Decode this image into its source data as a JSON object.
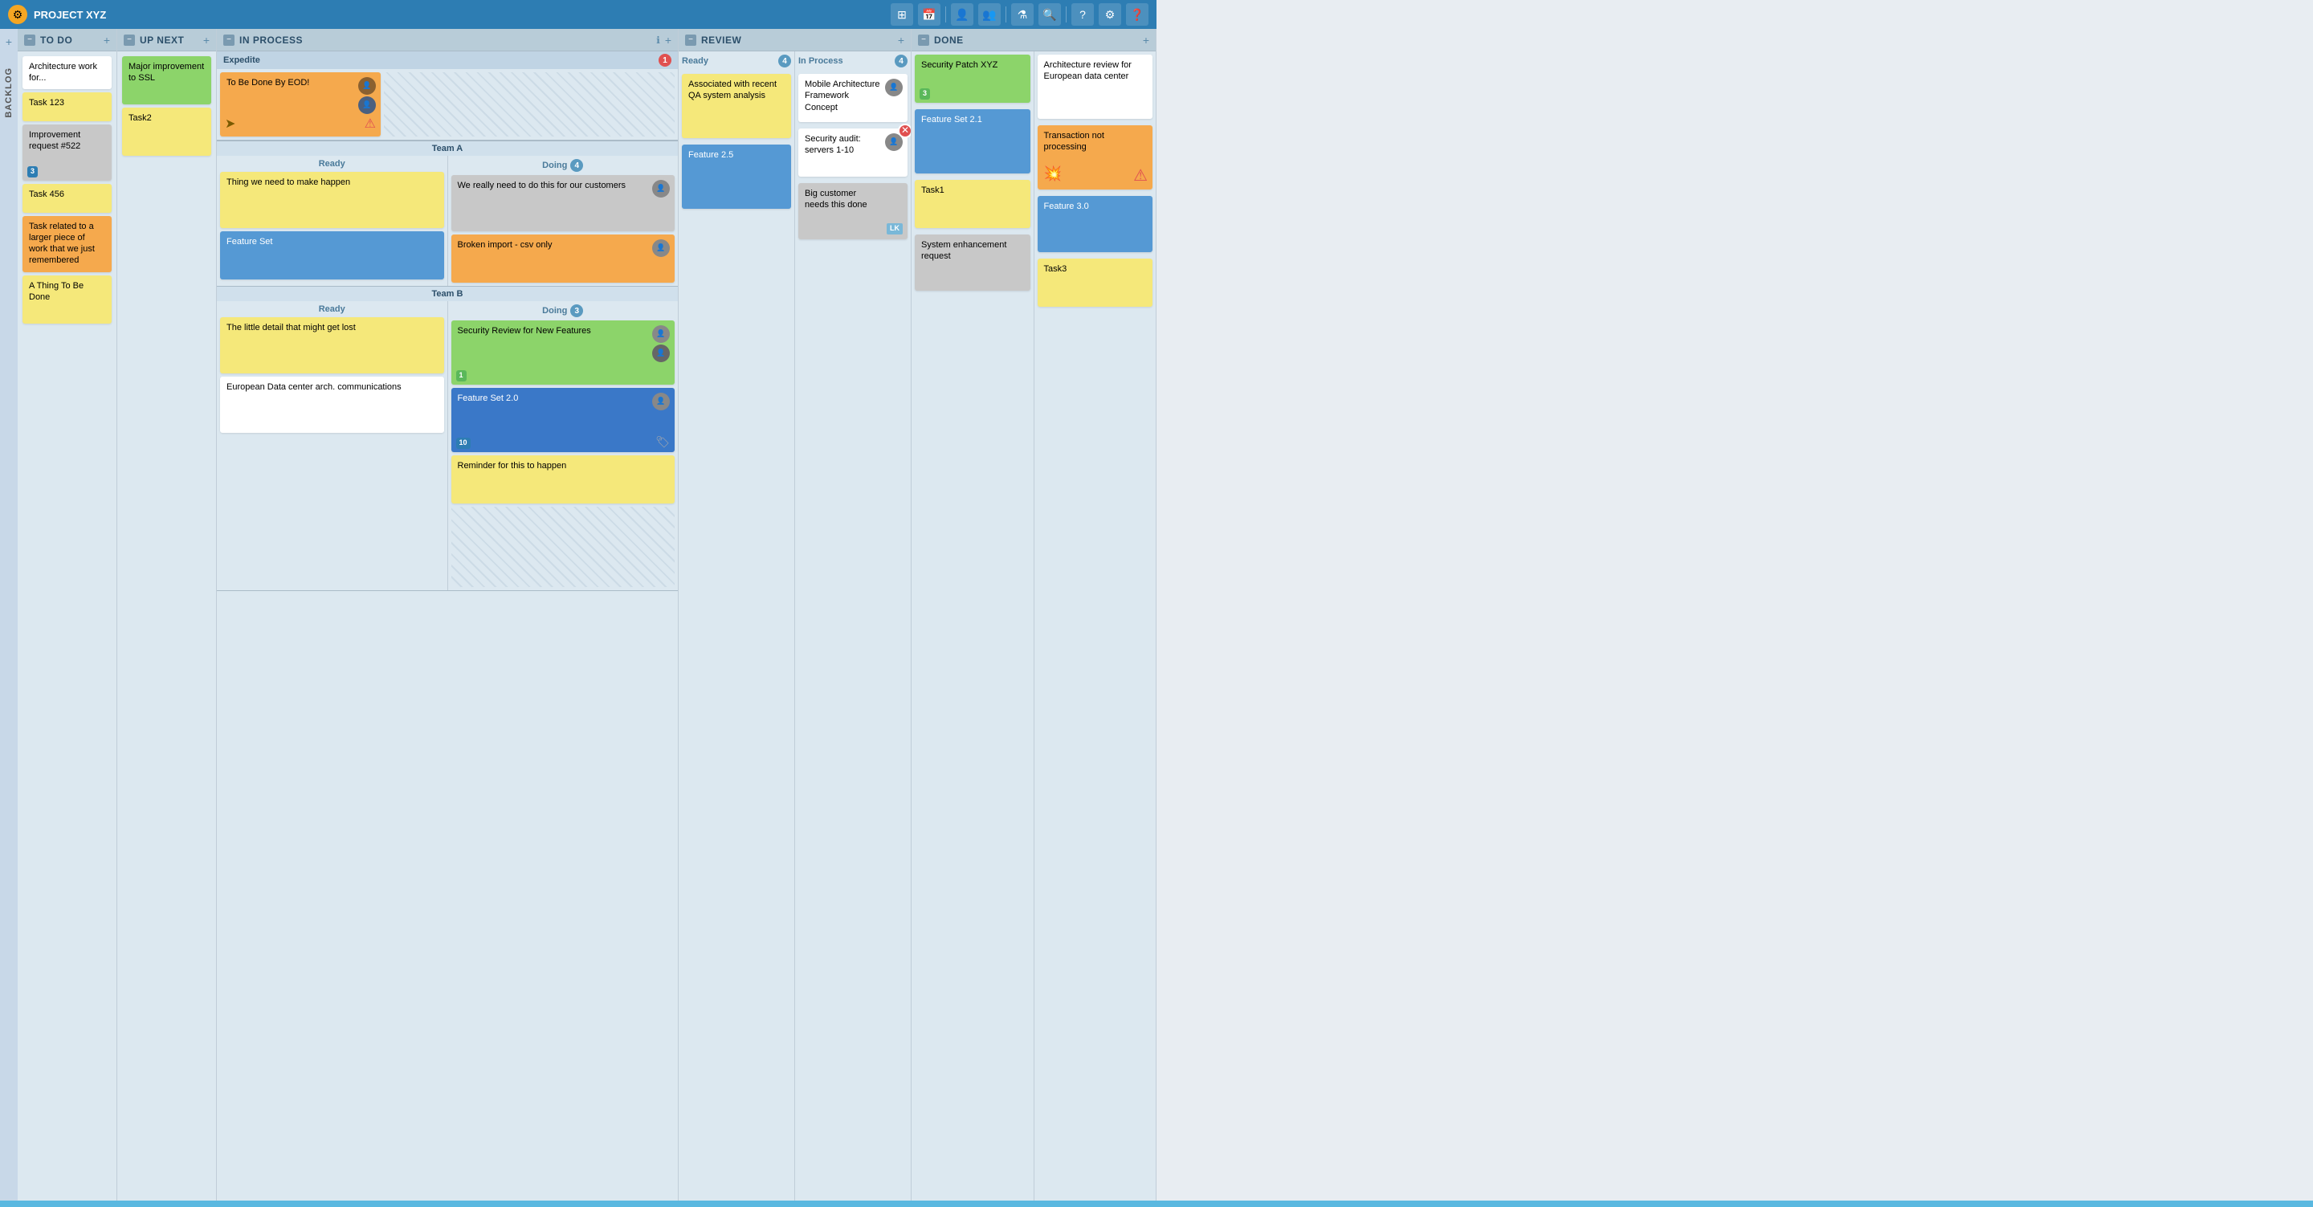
{
  "app": {
    "title": "PROJECT XYZ",
    "logo": "⚙"
  },
  "header": {
    "icons": [
      "grid-icon",
      "calendar-icon",
      "person-icon",
      "people-icon",
      "filter-icon",
      "search-icon",
      "help-circle-icon",
      "gear-icon",
      "question-icon"
    ]
  },
  "columns": {
    "backlog": {
      "label": "BACKLOG"
    },
    "todo": {
      "title": "TO DO",
      "cards": [
        {
          "id": "todo-1",
          "text": "Architecture work for...",
          "color": "white"
        },
        {
          "id": "todo-2",
          "text": "Task 123",
          "color": "yellow"
        },
        {
          "id": "todo-3",
          "text": "Improvement request #522",
          "color": "gray",
          "badge": "3"
        },
        {
          "id": "todo-4",
          "text": "Task 456",
          "color": "yellow"
        },
        {
          "id": "todo-5",
          "text": "Task related to a larger piece of work that we just remembered",
          "color": "orange"
        },
        {
          "id": "todo-6",
          "text": "A Thing To Be Done",
          "color": "yellow"
        }
      ]
    },
    "upnext": {
      "title": "UP NEXT",
      "cards": [
        {
          "id": "upnext-1",
          "text": "Major improvement to SSL",
          "color": "green"
        },
        {
          "id": "upnext-2",
          "text": "Task2",
          "color": "yellow"
        }
      ]
    },
    "inprocess": {
      "title": "IN PROCESS",
      "expedite": {
        "label": "Expedite",
        "count": "1",
        "card": {
          "id": "exp-1",
          "text": "To Be Done By EOD!",
          "color": "orange",
          "hasArrow": true,
          "hasPriority": true,
          "hasAvatars": true
        }
      },
      "teams": [
        {
          "name": "Team A",
          "ready": {
            "label": "Ready",
            "cards": [
              {
                "id": "ta-r1",
                "text": "Thing we need to make happen",
                "color": "yellow"
              },
              {
                "id": "ta-r2",
                "text": "Feature Set",
                "color": "blue"
              }
            ]
          },
          "doing": {
            "label": "Doing",
            "count": "4",
            "cards": [
              {
                "id": "ta-d1",
                "text": "We really need to do this for our customers",
                "color": "gray",
                "hasAvatar": true
              },
              {
                "id": "ta-d2",
                "text": "Broken import - csv only",
                "color": "orange",
                "hasAvatar": true
              }
            ]
          }
        },
        {
          "name": "Team B",
          "ready": {
            "label": "Ready",
            "cards": [
              {
                "id": "tb-r1",
                "text": "The little detail that might get lost",
                "color": "yellow"
              },
              {
                "id": "tb-r2",
                "text": "European Data center arch. communications",
                "color": "white"
              }
            ]
          },
          "doing": {
            "label": "Doing",
            "count": "3",
            "cards": [
              {
                "id": "tb-d1",
                "text": "Security Review for New Features",
                "color": "green",
                "hasAvatar": true,
                "badge": "1"
              },
              {
                "id": "tb-d2",
                "text": "Feature Set 2.0",
                "color": "blue",
                "hasAvatar": true,
                "badge": "10",
                "hasTag": true
              },
              {
                "id": "tb-d3",
                "text": "Reminder for this to happen",
                "color": "yellow"
              }
            ]
          }
        }
      ]
    },
    "review": {
      "title": "REVIEW",
      "ready": {
        "label": "Ready",
        "count": "4",
        "cards": [
          {
            "id": "rv-r1",
            "text": "Associated with recent QA system analysis",
            "color": "yellow"
          },
          {
            "id": "rv-r2",
            "text": "Feature 2.5",
            "color": "blue"
          }
        ]
      },
      "inprocess": {
        "label": "In Process",
        "count": "4",
        "cards": [
          {
            "id": "rv-ip1",
            "text": "Mobile Architecture Framework Concept",
            "color": "white",
            "hasAvatar": true
          },
          {
            "id": "rv-ip2",
            "text": "Security audit: servers 1-10",
            "color": "white",
            "hasAvatar": true
          },
          {
            "id": "rv-ip3",
            "text": "Big customer needs this done",
            "color": "gray",
            "hasInitials": "LK"
          }
        ]
      }
    },
    "done": {
      "title": "DONE",
      "col1": {
        "cards": [
          {
            "id": "done-1",
            "text": "Security Patch XYZ",
            "color": "green",
            "hasBadge": "3"
          },
          {
            "id": "done-2",
            "text": "Feature Set 2.1",
            "color": "blue",
            "hasClose": true
          },
          {
            "id": "done-3",
            "text": "Task1",
            "color": "yellow"
          },
          {
            "id": "done-4",
            "text": "System enhancement request",
            "color": "gray"
          }
        ]
      },
      "col2": {
        "cards": [
          {
            "id": "done-5",
            "text": "Architecture review for European data center",
            "color": "white"
          },
          {
            "id": "done-6",
            "text": "Transaction not processing",
            "color": "orange",
            "hasPriority": true
          },
          {
            "id": "done-7",
            "text": "Feature 3.0",
            "color": "blue"
          },
          {
            "id": "done-8",
            "text": "Task3",
            "color": "yellow"
          }
        ]
      }
    }
  }
}
